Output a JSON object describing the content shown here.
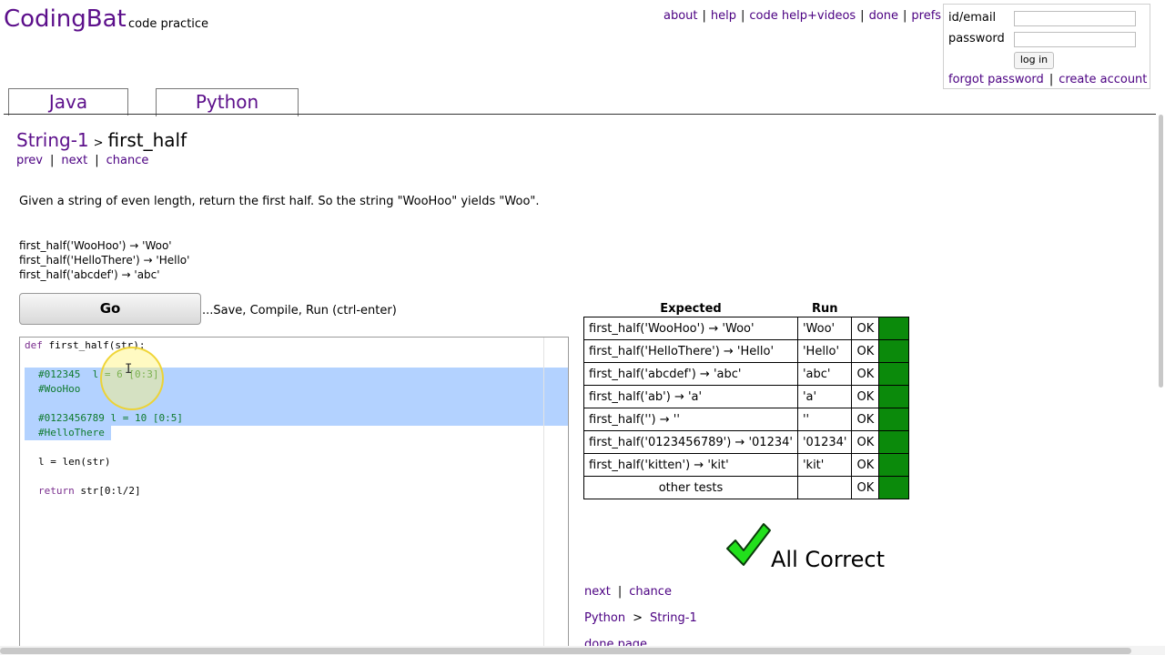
{
  "header": {
    "logo": "CodingBat",
    "tagline": "code practice",
    "nav": [
      "about",
      "help",
      "code help+videos",
      "done",
      "prefs"
    ]
  },
  "login": {
    "id_label": "id/email",
    "password_label": "password",
    "login_button": "log in",
    "forgot": "forgot password",
    "create": "create account"
  },
  "tabs": [
    "Java",
    "Python"
  ],
  "breadcrumb": {
    "section": "String-1",
    "separator": ">",
    "problem": "first_half"
  },
  "problem_nav": [
    "prev",
    "next",
    "chance"
  ],
  "description": "Given a string of even length, return the first half. So the string \"WooHoo\" yields \"Woo\".",
  "examples": [
    "first_half('WooHoo') → 'Woo'",
    "first_half('HelloThere') → 'Hello'",
    "first_half('abcdef') → 'abc'"
  ],
  "go": {
    "label": "Go",
    "hint": "...Save, Compile, Run (ctrl-enter)"
  },
  "code": {
    "def_kw": "def",
    "def_rest": " first_half(str):",
    "c1": "#012345  l = 6 [0:3]",
    "c2": "#WooHoo",
    "c3": "#0123456789 l = 10 [0:5]",
    "c4": "#HelloThere",
    "l5": "l = len(str)",
    "ret_kw": "return",
    "ret_rest": " str[0:l/2]"
  },
  "results": {
    "headers": {
      "expected": "Expected",
      "run": "Run"
    },
    "rows": [
      {
        "expected": "first_half('WooHoo') → 'Woo'",
        "run": "'Woo'",
        "status": "OK"
      },
      {
        "expected": "first_half('HelloThere') → 'Hello'",
        "run": "'Hello'",
        "status": "OK"
      },
      {
        "expected": "first_half('abcdef') → 'abc'",
        "run": "'abc'",
        "status": "OK"
      },
      {
        "expected": "first_half('ab') → 'a'",
        "run": "'a'",
        "status": "OK"
      },
      {
        "expected": "first_half('') → ''",
        "run": "''",
        "status": "OK"
      },
      {
        "expected": "first_half('0123456789') → '01234'",
        "run": "'01234'",
        "status": "OK"
      },
      {
        "expected": "first_half('kitten') → 'kit'",
        "run": "'kit'",
        "status": "OK"
      },
      {
        "expected": "other tests",
        "run": "",
        "status": "OK"
      }
    ],
    "pass_color": "#0b8a0b"
  },
  "all_correct": "All Correct",
  "bottom_nav": [
    "next",
    "chance"
  ],
  "bottom_crumb": [
    "Python",
    ">",
    "String-1"
  ],
  "done_page": "done page"
}
